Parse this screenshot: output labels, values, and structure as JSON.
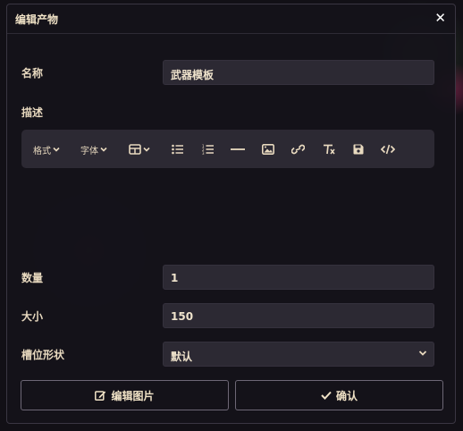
{
  "dialog": {
    "title": "编辑产物",
    "close_glyph": "✕"
  },
  "form": {
    "name_label": "名称",
    "name_value": "武器模板",
    "desc_label": "描述",
    "qty_label": "数量",
    "qty_value": "1",
    "size_label": "大小",
    "size_value": "150",
    "slot_label": "槽位形状",
    "slot_value": "默认"
  },
  "toolbar": {
    "format_label": "格式",
    "font_label": "字体",
    "icons": [
      "table-icon",
      "bullet-list-icon",
      "numbered-list-icon",
      "horizontal-rule-icon",
      "image-icon",
      "link-icon",
      "clear-format-icon",
      "save-icon",
      "code-icon"
    ]
  },
  "buttons": {
    "edit_image": "编辑图片",
    "confirm": "确认"
  }
}
